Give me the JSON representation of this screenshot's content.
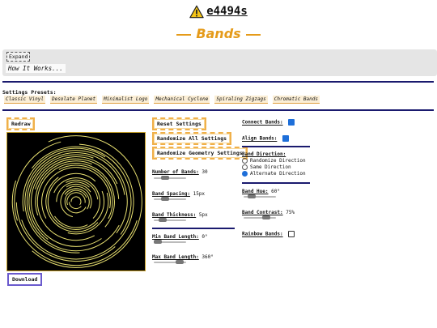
{
  "header": {
    "site_name": "e4494s",
    "title": "Bands"
  },
  "explanation": {
    "expand_label": "Expand",
    "summary": "How It Works..."
  },
  "presets": {
    "label": "Settings Presets:",
    "items": [
      "Classic Vinyl",
      "Desolate Planet",
      "Minimalist Logo",
      "Mechanical Cyclone",
      "Spiraling Zigzags",
      "Chromatic Bands"
    ]
  },
  "canvas": {
    "redraw_label": "Redraw",
    "download_label": "Download"
  },
  "buttons": {
    "reset": "Reset Settings",
    "randomize_all": "Randomize All Settings",
    "randomize_geometry": "Randomize Geometry Settings"
  },
  "controls": {
    "num_bands": {
      "label": "Number of Bands:",
      "value": "30",
      "fraction": 0.3
    },
    "band_spacing": {
      "label": "Band Spacing:",
      "value": "15px",
      "fraction": 0.3
    },
    "band_thickness": {
      "label": "Band Thickness:",
      "value": "5px",
      "fraction": 0.2
    },
    "min_band_length": {
      "label": "Min Band Length:",
      "value": "0°",
      "fraction": 0.0
    },
    "max_band_length": {
      "label": "Max Band Length:",
      "value": "360°",
      "fraction": 0.9
    },
    "connect_bands": {
      "label": "Connect Bands:",
      "checked": true
    },
    "align_bands": {
      "label": "Align Bands:",
      "checked": true
    },
    "band_direction": {
      "label": "Band Direction:",
      "options": [
        "Randomize Direction",
        "Same Direction",
        "Alternate Direction"
      ],
      "selected": 2
    },
    "band_hue": {
      "label": "Band Hue:",
      "value": "60°",
      "fraction": 0.17
    },
    "band_contrast": {
      "label": "Band Contrast:",
      "value": "75%",
      "fraction": 0.75
    },
    "rainbow_bands": {
      "label": "Rainbow Bands:",
      "checked": false
    }
  },
  "colors": {
    "accent": "#e59b1a",
    "rule": "#1a1a6e",
    "band": "#e8e070"
  }
}
